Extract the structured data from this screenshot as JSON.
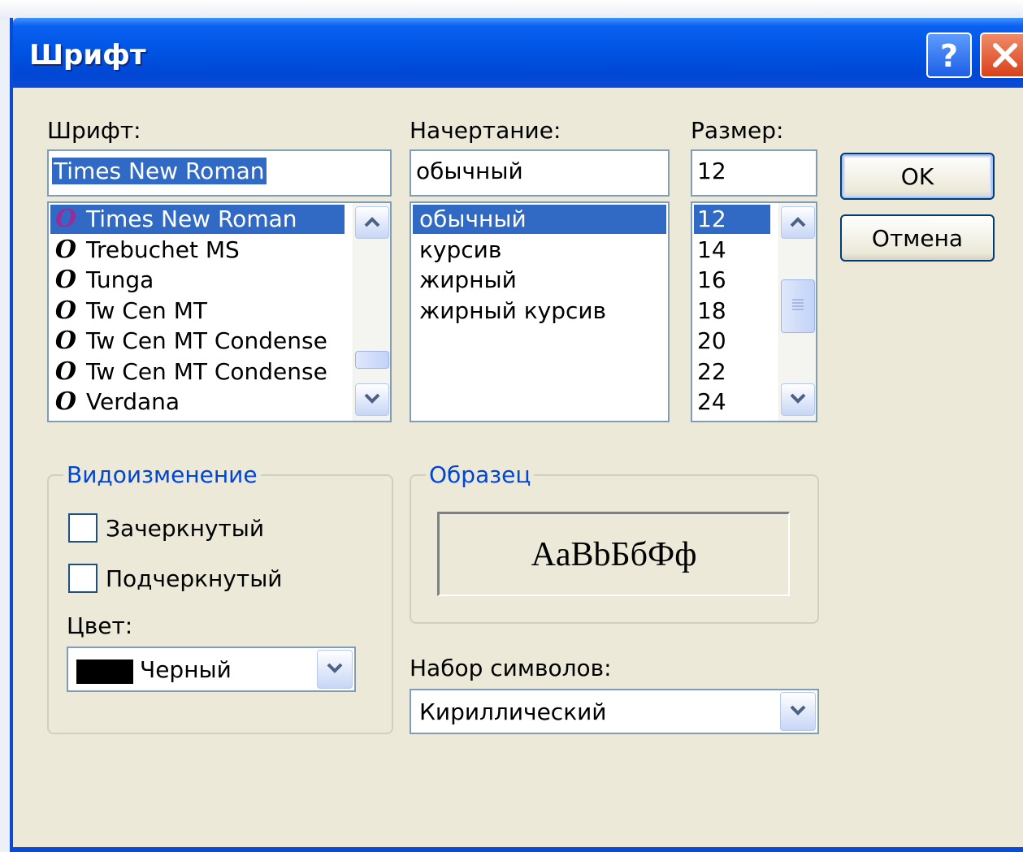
{
  "window": {
    "title": "Шрифт",
    "help_icon": "help-icon",
    "close_icon": "close-icon"
  },
  "font": {
    "label": "Шрифт:",
    "value": "Times New Roman",
    "items": [
      "Times New Roman",
      "Trebuchet MS",
      "Tunga",
      "Tw Cen MT",
      "Tw Cen MT Condense",
      "Tw Cen MT Condense",
      "Verdana"
    ],
    "selected_index": 0,
    "item_icon": "opentype-font-icon",
    "glyph": "O"
  },
  "style": {
    "label": "Начертание:",
    "value": "обычный",
    "items": [
      "обычный",
      "курсив",
      "жирный",
      "жирный курсив"
    ],
    "selected_index": 0
  },
  "size": {
    "label": "Размер:",
    "value": "12",
    "items": [
      "12",
      "14",
      "16",
      "18",
      "20",
      "22",
      "24"
    ],
    "selected_index": 0
  },
  "buttons": {
    "ok": "OK",
    "cancel": "Отмена"
  },
  "effects": {
    "title": "Видоизменение",
    "strikeout": {
      "label": "Зачеркнутый",
      "checked": false
    },
    "underline": {
      "label": "Подчеркнутый",
      "checked": false
    },
    "color_label": "Цвет:",
    "color_value": "Черный",
    "color_swatch": "#000000"
  },
  "sample": {
    "title": "Образец",
    "text": "AaBbБбФф"
  },
  "charset": {
    "label": "Набор символов:",
    "value": "Кириллический"
  },
  "colors": {
    "titlebar": "#0055e5",
    "dialog_bg": "#ece9d8",
    "selection": "#316ac5",
    "group_title": "#0046d5"
  }
}
